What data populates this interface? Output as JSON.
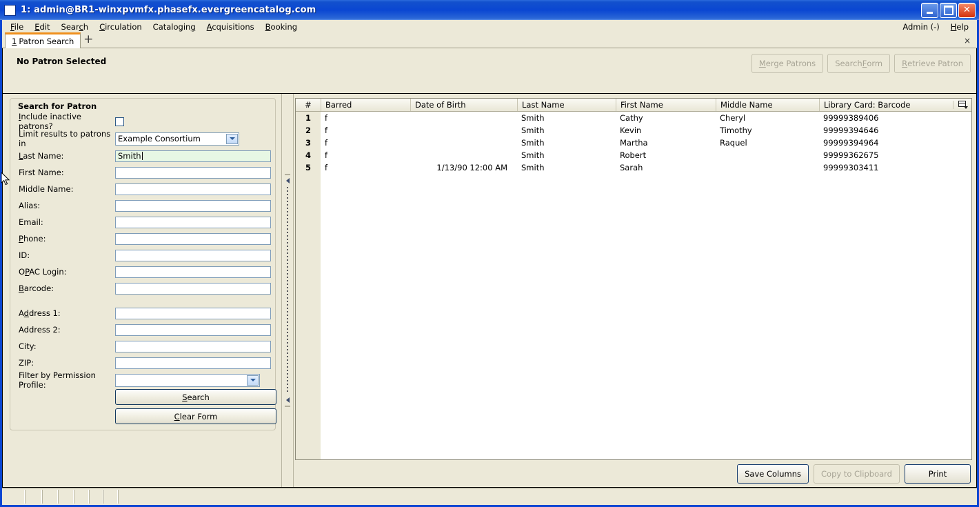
{
  "window": {
    "title": "1: admin@BR1-winxpvmfx.phasefx.evergreencatalog.com",
    "minimize_label": "",
    "maximize_label": "",
    "close_label": "✕"
  },
  "menubar": {
    "items": [
      {
        "label": "File",
        "accel": "F"
      },
      {
        "label": "Edit",
        "accel": "E"
      },
      {
        "label": "Search",
        "accel": "c"
      },
      {
        "label": "Circulation",
        "accel": "C"
      },
      {
        "label": "Cataloging",
        "accel": "g"
      },
      {
        "label": "Acquisitions",
        "accel": "A"
      },
      {
        "label": "Booking",
        "accel": "B"
      }
    ],
    "right_items": [
      {
        "label": "Admin (-)",
        "accel": ""
      },
      {
        "label": "Help",
        "accel": "H"
      }
    ]
  },
  "tabs": {
    "items": [
      {
        "number": "1",
        "label": "Patron Search",
        "active": true
      }
    ],
    "new_tab_label": "+",
    "close_label": "×"
  },
  "patron_header": {
    "title": "No Patron Selected",
    "buttons": [
      {
        "label": "Merge Patrons",
        "accel": "M",
        "enabled": false
      },
      {
        "label": "Search Form",
        "accel": "F",
        "enabled": false
      },
      {
        "label": "Retrieve Patron",
        "accel": "R",
        "enabled": false
      }
    ]
  },
  "search_form": {
    "legend": "Search for Patron",
    "fields": [
      {
        "name": "include-inactive",
        "label": "Include inactive patrons?",
        "accel": "I",
        "type": "checkbox",
        "checked": false,
        "value": ""
      },
      {
        "name": "limit-results",
        "label": "Limit results to patrons in",
        "accel": "",
        "type": "select",
        "value": "Example Consortium"
      },
      {
        "name": "last-name",
        "label": "Last Name:",
        "accel": "L",
        "type": "text",
        "value": "Smith",
        "focused": true
      },
      {
        "name": "first-name",
        "label": "First Name:",
        "accel": "",
        "type": "text",
        "value": ""
      },
      {
        "name": "middle-name",
        "label": "Middle Name:",
        "accel": "",
        "type": "text",
        "value": ""
      },
      {
        "name": "alias",
        "label": "Alias:",
        "accel": "",
        "type": "text",
        "value": ""
      },
      {
        "name": "email",
        "label": "Email:",
        "accel": "",
        "type": "text",
        "value": ""
      },
      {
        "name": "phone",
        "label": "Phone:",
        "accel": "P",
        "type": "text",
        "value": ""
      },
      {
        "name": "id",
        "label": "ID:",
        "accel": "",
        "type": "text",
        "value": ""
      },
      {
        "name": "opac-login",
        "label": "OPAC Login:",
        "accel": "O",
        "type": "text",
        "value": ""
      },
      {
        "name": "barcode",
        "label": "Barcode:",
        "accel": "B",
        "type": "text",
        "value": ""
      },
      {
        "name": "address-1",
        "label": "Address 1:",
        "accel": "d",
        "type": "text",
        "value": "",
        "gap_before": true
      },
      {
        "name": "address-2",
        "label": "Address 2:",
        "accel": "",
        "type": "text",
        "value": ""
      },
      {
        "name": "city",
        "label": "City:",
        "accel": "",
        "type": "text",
        "value": ""
      },
      {
        "name": "zip",
        "label": "ZIP:",
        "accel": "",
        "type": "text",
        "value": ""
      },
      {
        "name": "permission-profile",
        "label": "Filter by Permission Profile:",
        "accel": "",
        "type": "select",
        "value": ""
      }
    ],
    "buttons": [
      {
        "name": "search-button",
        "label": "Search",
        "accel": "S"
      },
      {
        "name": "clear-form-button",
        "label": "Clear Form",
        "accel": "C"
      }
    ]
  },
  "results": {
    "columns": [
      {
        "key": "num",
        "label": "#"
      },
      {
        "key": "barred",
        "label": "Barred"
      },
      {
        "key": "dob",
        "label": "Date of Birth"
      },
      {
        "key": "last",
        "label": "Last Name"
      },
      {
        "key": "first",
        "label": "First Name"
      },
      {
        "key": "middle",
        "label": "Middle Name"
      },
      {
        "key": "barcode",
        "label": "Library Card: Barcode"
      }
    ],
    "rows": [
      {
        "num": "1",
        "barred": "f",
        "dob": "",
        "last": "Smith",
        "first": "Cathy",
        "middle": "Cheryl",
        "barcode": "99999389406"
      },
      {
        "num": "2",
        "barred": "f",
        "dob": "",
        "last": "Smith",
        "first": "Kevin",
        "middle": "Timothy",
        "barcode": "99999394646"
      },
      {
        "num": "3",
        "barred": "f",
        "dob": "",
        "last": "Smith",
        "first": "Martha",
        "middle": "Raquel",
        "barcode": "99999394964"
      },
      {
        "num": "4",
        "barred": "f",
        "dob": "",
        "last": "Smith",
        "first": "Robert",
        "middle": "",
        "barcode": "99999362675"
      },
      {
        "num": "5",
        "barred": "f",
        "dob": "1/13/90 12:00 AM",
        "last": "Smith",
        "first": "Sarah",
        "middle": "",
        "barcode": "99999303411"
      }
    ],
    "footer_buttons": [
      {
        "name": "save-columns-button",
        "label": "Save Columns",
        "enabled": true
      },
      {
        "name": "copy-clipboard-button",
        "label": "Copy to Clipboard",
        "enabled": false
      },
      {
        "name": "print-button",
        "label": "Print",
        "enabled": true
      }
    ]
  },
  "statusbar": {
    "segments": [
      "",
      "",
      "",
      "",
      "",
      "",
      "",
      ""
    ]
  },
  "colors": {
    "titlebar": "#0a46d2",
    "chrome": "#ece9d8",
    "tab_accent": "#ef8f1c",
    "focus_field": "#e7f7e4",
    "field_border": "#7f9db9"
  }
}
